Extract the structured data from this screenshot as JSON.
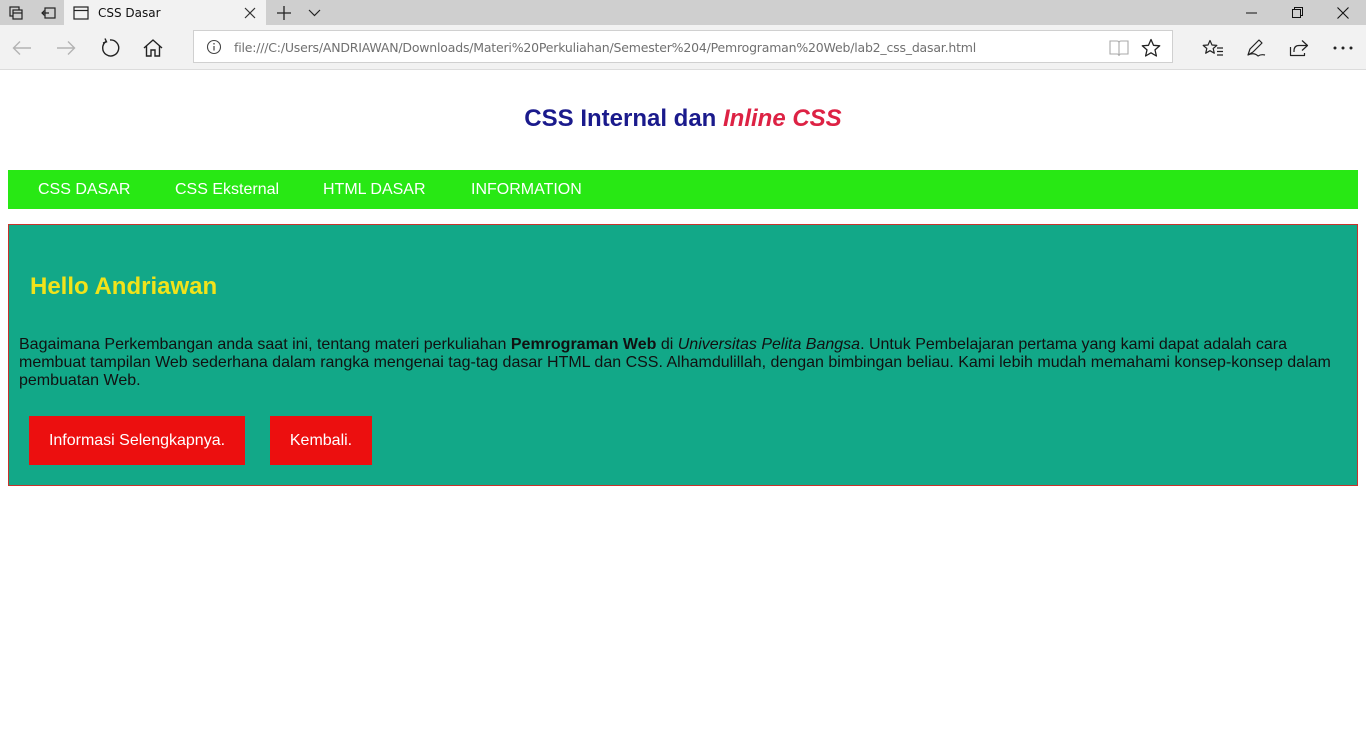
{
  "browser": {
    "tab_title": "CSS Dasar",
    "url": "file:///C:/Users/ANDRIAWAN/Downloads/Materi%20Perkuliahan/Semester%204/Pemrograman%20Web/lab2_css_dasar.html",
    "icons": {
      "tab_actions": "tab-actions-icon",
      "set_aside": "set-aside-tabs-icon",
      "page": "page-icon",
      "close": "close-icon",
      "new_tab": "plus-icon",
      "tab_list": "chevron-down-icon",
      "minimize": "minimize-icon",
      "restore": "restore-icon",
      "window_close": "close-icon",
      "back": "back-arrow-icon",
      "forward": "forward-arrow-icon",
      "refresh": "refresh-icon",
      "home": "home-icon",
      "info": "info-icon",
      "reading_view": "reading-view-icon",
      "favorite": "star-icon",
      "favorites_hub": "favorites-icon",
      "notes": "pen-icon",
      "share": "share-icon",
      "more": "more-icon"
    }
  },
  "page": {
    "heading_main": "CSS Internal dan ",
    "heading_accent": "Inline CSS",
    "menu": [
      {
        "label": "CSS DASAR"
      },
      {
        "label": "CSS Eksternal"
      },
      {
        "label": "HTML DASAR"
      },
      {
        "label": "INFORMATION"
      }
    ],
    "panel": {
      "title": "Hello Andriawan",
      "text_1": "Bagaimana Perkembangan anda saat ini, tentang materi perkuliahan ",
      "text_bold": "Pemrograman Web",
      "text_2": " di ",
      "text_italic": "Universitas Pelita Bangsa",
      "text_3": ". Untuk Pembelajaran pertama yang kami dapat adalah cara membuat tampilan Web sederhana dalam rangka mengenai tag-tag dasar HTML dan CSS. Alhamdulillah, dengan bimbingan beliau. Kami lebih mudah memahami konsep-konsep dalam pembuatan Web.",
      "button_more": "Informasi Selengkapnya.",
      "button_back": "Kembali."
    }
  },
  "colors": {
    "heading": "#1a1a8c",
    "heading_accent": "#dd2244",
    "menu_bg": "#28e814",
    "panel_bg": "#12a888",
    "panel_border": "#c8332c",
    "panel_title": "#f1e31a",
    "button_bg": "#ec0f0f"
  }
}
